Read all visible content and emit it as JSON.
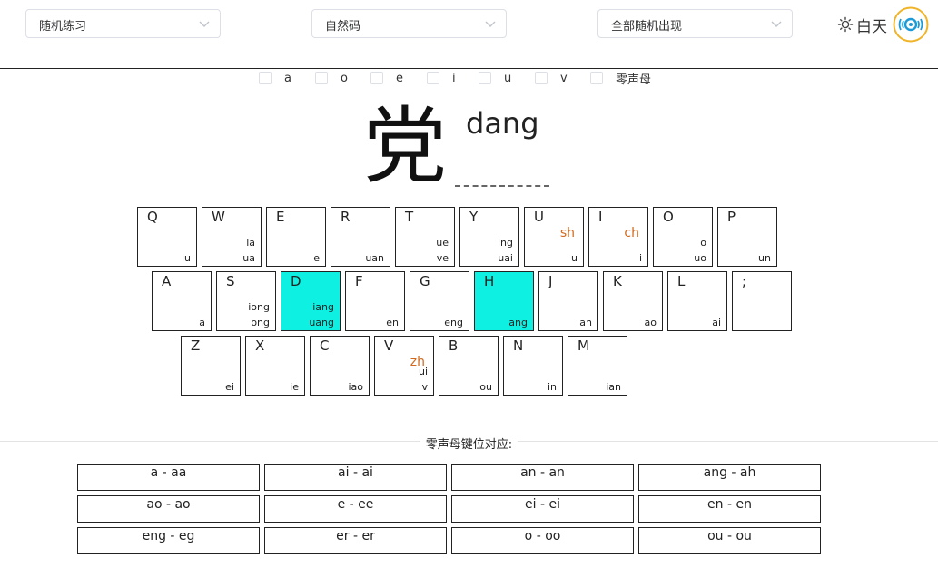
{
  "selects": [
    {
      "id": "mode",
      "value": "随机练习"
    },
    {
      "id": "scheme",
      "value": "自然码"
    },
    {
      "id": "range",
      "value": "全部随机出现"
    }
  ],
  "theme": {
    "label": "白天",
    "icon": "sun-icon"
  },
  "avatar": {
    "icon": "logo-avatar-icon"
  },
  "filters": [
    "a",
    "o",
    "e",
    "i",
    "u",
    "v",
    "零声母"
  ],
  "practice": {
    "character": "党",
    "pinyin": "dang",
    "answer": ""
  },
  "keyboard": {
    "rows": [
      [
        {
          "letter": "Q",
          "shengmu": "",
          "yun1": "",
          "yun2": "iu",
          "highlight": false
        },
        {
          "letter": "W",
          "shengmu": "",
          "yun1": "ia",
          "yun2": "ua",
          "highlight": false
        },
        {
          "letter": "E",
          "shengmu": "",
          "yun1": "",
          "yun2": "e",
          "highlight": false
        },
        {
          "letter": "R",
          "shengmu": "",
          "yun1": "",
          "yun2": "uan",
          "highlight": false
        },
        {
          "letter": "T",
          "shengmu": "",
          "yun1": "ue",
          "yun2": "ve",
          "highlight": false
        },
        {
          "letter": "Y",
          "shengmu": "",
          "yun1": "ing",
          "yun2": "uai",
          "highlight": false
        },
        {
          "letter": "U",
          "shengmu": "sh",
          "yun1": "",
          "yun2": "u",
          "highlight": false
        },
        {
          "letter": "I",
          "shengmu": "ch",
          "yun1": "",
          "yun2": "i",
          "highlight": false
        },
        {
          "letter": "O",
          "shengmu": "",
          "yun1": "o",
          "yun2": "uo",
          "highlight": false
        },
        {
          "letter": "P",
          "shengmu": "",
          "yun1": "",
          "yun2": "un",
          "highlight": false
        }
      ],
      [
        {
          "letter": "A",
          "shengmu": "",
          "yun1": "",
          "yun2": "a",
          "highlight": false
        },
        {
          "letter": "S",
          "shengmu": "",
          "yun1": "iong",
          "yun2": "ong",
          "highlight": false
        },
        {
          "letter": "D",
          "shengmu": "",
          "yun1": "iang",
          "yun2": "uang",
          "highlight": true
        },
        {
          "letter": "F",
          "shengmu": "",
          "yun1": "",
          "yun2": "en",
          "highlight": false
        },
        {
          "letter": "G",
          "shengmu": "",
          "yun1": "",
          "yun2": "eng",
          "highlight": false
        },
        {
          "letter": "H",
          "shengmu": "",
          "yun1": "",
          "yun2": "ang",
          "highlight": true
        },
        {
          "letter": "J",
          "shengmu": "",
          "yun1": "",
          "yun2": "an",
          "highlight": false
        },
        {
          "letter": "K",
          "shengmu": "",
          "yun1": "",
          "yun2": "ao",
          "highlight": false
        },
        {
          "letter": "L",
          "shengmu": "",
          "yun1": "",
          "yun2": "ai",
          "highlight": false
        },
        {
          "letter": ";",
          "shengmu": "",
          "yun1": "",
          "yun2": "",
          "highlight": false
        }
      ],
      [
        {
          "letter": "Z",
          "shengmu": "",
          "yun1": "",
          "yun2": "ei",
          "highlight": false
        },
        {
          "letter": "X",
          "shengmu": "",
          "yun1": "",
          "yun2": "ie",
          "highlight": false
        },
        {
          "letter": "C",
          "shengmu": "",
          "yun1": "",
          "yun2": "iao",
          "highlight": false
        },
        {
          "letter": "V",
          "shengmu": "zh",
          "yun1": "ui",
          "yun2": "v",
          "highlight": false
        },
        {
          "letter": "B",
          "shengmu": "",
          "yun1": "",
          "yun2": "ou",
          "highlight": false
        },
        {
          "letter": "N",
          "shengmu": "",
          "yun1": "",
          "yun2": "in",
          "highlight": false
        },
        {
          "letter": "M",
          "shengmu": "",
          "yun1": "",
          "yun2": "ian",
          "highlight": false
        }
      ]
    ]
  },
  "zero_initial": {
    "title": "零声母键位对应:",
    "pairs": [
      "a - aa",
      "ai - ai",
      "an - an",
      "ang - ah",
      "ao - ao",
      "e - ee",
      "ei - ei",
      "en - en",
      "eng - eg",
      "er - er",
      "o - oo",
      "ou - ou"
    ]
  }
}
